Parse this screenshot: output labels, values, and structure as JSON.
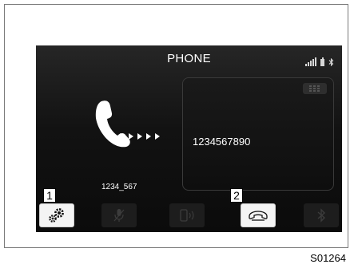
{
  "screen": {
    "title": "PHONE",
    "status_icons": [
      "signal-icon",
      "battery-icon",
      "bluetooth-icon"
    ]
  },
  "call": {
    "number": "1234567890",
    "contact_name": "1234_567"
  },
  "bottom_bar": {
    "buttons": [
      {
        "name": "settings-button",
        "icon": "gear-icon",
        "state": "active"
      },
      {
        "name": "mute-button",
        "icon": "microphone-muted-icon",
        "state": "disabled"
      },
      {
        "name": "handsfree-button",
        "icon": "phone-speaker-icon",
        "state": "disabled"
      },
      {
        "name": "hang-up-button",
        "icon": "hang-up-icon",
        "state": "active"
      },
      {
        "name": "bluetooth-button",
        "icon": "bluetooth-icon",
        "state": "disabled"
      }
    ]
  },
  "callouts": {
    "one": "1",
    "two": "2"
  },
  "figure_code": "S01264",
  "colors": {
    "screen_bg": "#121212",
    "text": "#ffffff",
    "active_button": "#f4f4f4",
    "inactive_icon": "#3c3c3c"
  }
}
